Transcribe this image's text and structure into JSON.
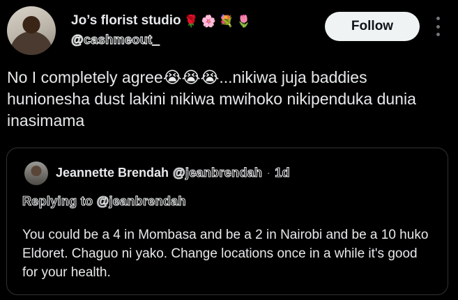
{
  "author": {
    "name": "Jo’s florist studio",
    "emojis": [
      "🌹",
      "🌸",
      "💐",
      "🌷"
    ],
    "handle": "@cashmeout_"
  },
  "follow_label": "Follow",
  "tweet": {
    "text": "No I completely agree😭😭😭...nikiwa juja baddies hunionesha dust lakini nikiwa mwihoko nikipenduka dunia inasimama"
  },
  "quote": {
    "name": "Jeannette Brendah",
    "handle": "@jeanbrendah",
    "separator": "·",
    "time": "1d",
    "replying_to": "Replying to @jeanbrendah",
    "text": "You could be a 4 in Mombasa and be a 2 in Nairobi and be a 10 huko Eldoret. Chaguo ni yako. Change locations once in a while it's good for your health."
  }
}
